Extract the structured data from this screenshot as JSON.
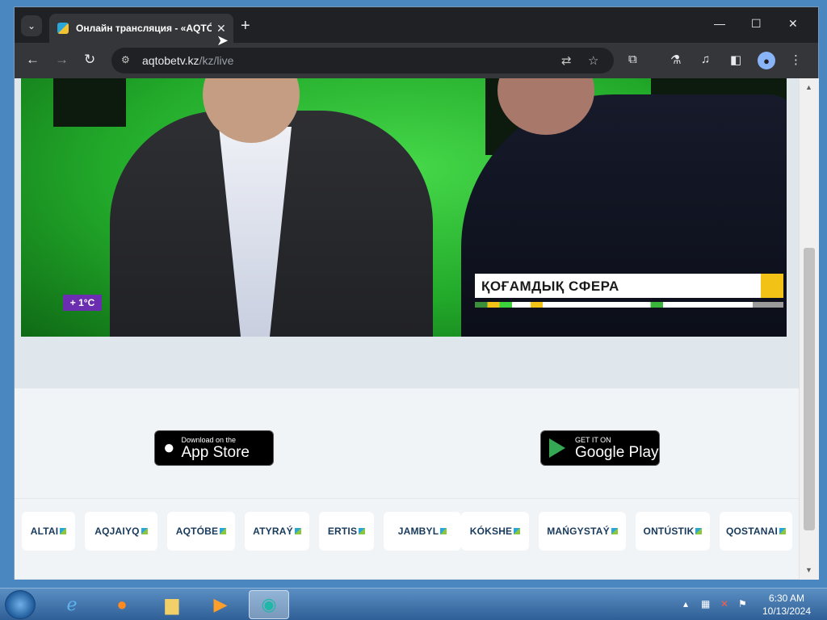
{
  "browser": {
    "tab_title": "Онлайн трансляция - «AQTÓBE»",
    "url_host": "aqtobetv.kz",
    "url_path": "/kz/live",
    "new_tab_symbol": "+",
    "close_tab_symbol": "✕",
    "window_controls": {
      "minimize": "—",
      "maximize": "☐",
      "close": "✕"
    }
  },
  "video": {
    "temperature": "+ 1°C",
    "lower_third": "ҚОҒАМДЫҚ СФЕРА"
  },
  "apps": {
    "app_store": {
      "small": "Download on the",
      "big": "App Store"
    },
    "google_play": {
      "small": "GET IT ON",
      "big": "Google Play"
    }
  },
  "channels": [
    "ALTAI",
    "AQJAIYQ",
    "AQTÓBE",
    "ATYRAÝ",
    "ERTIS",
    "JAMBYL",
    "KÓKSHE",
    "MAŃGYSTAÝ",
    "ONTÚSTIK",
    "QOSTANAI"
  ],
  "taskbar": {
    "time": "6:30 AM",
    "date": "10/13/2024"
  },
  "icons": {
    "back": "back-arrow-icon",
    "forward": "forward-arrow-icon",
    "reload": "reload-icon",
    "site_info": "site-settings-icon",
    "translate": "translate-icon",
    "bookmark": "star-icon",
    "extensions": "puzzle-icon",
    "labs": "flask-icon",
    "media": "media-control-icon",
    "side_panel": "side-panel-icon",
    "profile": "profile-icon",
    "menu": "kebab-menu-icon"
  }
}
